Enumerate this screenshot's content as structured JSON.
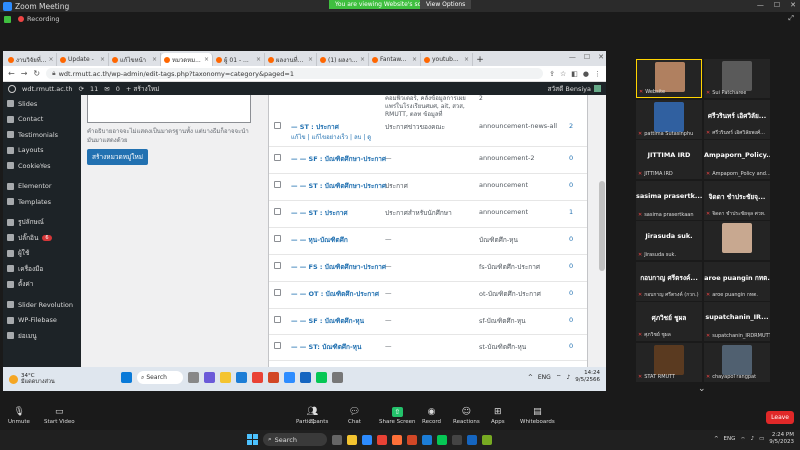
{
  "zoom": {
    "title": "Zoom Meeting",
    "share_notice": "You are viewing Website's screen",
    "view_options": "View Options",
    "recording": "Recording",
    "fullscreen_icon": "⤢",
    "winctl": [
      "—",
      "☐",
      "✕"
    ]
  },
  "browser": {
    "tabs": [
      {
        "label": "งานวิจัยที่...",
        "active": false
      },
      {
        "label": "Update -",
        "active": false
      },
      {
        "label": "แก้ไขหน้า",
        "active": false
      },
      {
        "label": "หมวดหม...",
        "active": true
      },
      {
        "label": "ผู้ 01 - ...",
        "active": false
      },
      {
        "label": "ผลงานที่...",
        "active": false
      },
      {
        "label": "(1) ผลงา...",
        "active": false
      },
      {
        "label": "Fantaw...",
        "active": false
      },
      {
        "label": "youtub...",
        "active": false
      }
    ],
    "new_tab": "+",
    "url": "wdt.rmutt.ac.th/wp-admin/edit-tags.php?taxonomy=category&paged=1"
  },
  "wp_admin_bar": {
    "site": "wdt.rmutt.ac.th",
    "updates": "11",
    "comments": "0",
    "new": "+ สร้างใหม่",
    "greeting": "สวัสดี Bensiya"
  },
  "sidebar": {
    "items": [
      {
        "label": "Slides",
        "badge": ""
      },
      {
        "label": "Contact",
        "badge": ""
      },
      {
        "label": "Testimonials",
        "badge": ""
      },
      {
        "label": "Layouts",
        "badge": ""
      },
      {
        "label": "CookieYes",
        "badge": ""
      },
      {
        "label": "Elementor",
        "badge": ""
      },
      {
        "label": "Templates",
        "badge": ""
      },
      {
        "label": "รูปลักษณ์",
        "badge": ""
      },
      {
        "label": "ปลั๊กอิน",
        "badge": "6"
      },
      {
        "label": "ผู้ใช้",
        "badge": ""
      },
      {
        "label": "เครื่องมือ",
        "badge": ""
      },
      {
        "label": "ตั้งค่า",
        "badge": ""
      },
      {
        "label": "Slider Revolution",
        "badge": ""
      },
      {
        "label": "WP-Filebase",
        "badge": ""
      },
      {
        "label": "ย่อเมนู",
        "badge": ""
      }
    ]
  },
  "form": {
    "help_text": "คำอธิบายอาจจะไม่แสดงเป็นมาตรฐานทั้ง แต่บางธีมก็อาจจะนำมันมาแสดงด้วย",
    "add_button": "สร้างหมวดหมู่ใหม่"
  },
  "table": {
    "top_desc": [
      "คอมพิวเตอร์, คลังข้อมูลการเผย",
      "แพร่ในโรงเรียนศมศ, ait, สวส,",
      "RMUTT, ตลท ข้อมูลที่"
    ],
    "top_count": "2",
    "row_actions": "แก้ไข | แก้ไขอย่างเร็ว | ลบ | ดู",
    "rows": [
      {
        "name": "— ST : ประกาศ",
        "desc": "ประกาศข่าวของคณะ",
        "slug": "announcement-news-all",
        "count": "2"
      },
      {
        "name": "— — SF : บัณฑิตศึกษา-ประกาศ",
        "desc": "—",
        "slug": "announcement-2",
        "count": "0"
      },
      {
        "name": "— — ST : บัณฑิตศึกษา-ประกาศ",
        "desc": "ประกาศ",
        "slug": "announcement",
        "count": "0"
      },
      {
        "name": "— — ST : ประกาศ",
        "desc": "ประกาศสำหรับนักศึกษา",
        "slug": "announcement",
        "count": "1"
      },
      {
        "name": "— — หุน-บัณฑิตศึก",
        "desc": "—",
        "slug": "บัณฑิตศึก-หุน",
        "count": "0"
      },
      {
        "name": "— — FS : บัณฑิตศึกษา-ประกาศ",
        "desc": "—",
        "slug": "fs-บัณฑิตศึก-ประกาศ",
        "count": "0"
      },
      {
        "name": "— — OT : บัณฑิตศึก-ประกาศ",
        "desc": "—",
        "slug": "ot-บัณฑิตศึก-ประกาศ",
        "count": "0"
      },
      {
        "name": "— — SF : บัณฑิตศึก-หุน",
        "desc": "—",
        "slug": "sf-บัณฑิตศึก-หุน",
        "count": "0"
      },
      {
        "name": "— — ST: บัณฑิตศึก-หุน",
        "desc": "—",
        "slug": "st-บัณฑิตศึก-หุน",
        "count": "0"
      }
    ]
  },
  "inner_taskbar": {
    "temp": "34°C",
    "weather": "มีแดดบางส่วน",
    "search": "Search",
    "lang": "ENG",
    "time": "14:24",
    "date": "9/5/2566"
  },
  "participants": [
    {
      "big": "",
      "small": "Website",
      "photo": "#b08060",
      "active": true
    },
    {
      "big": "",
      "small": "Sui Patcharee",
      "photo": "#5a5a5a",
      "active": false
    },
    {
      "big": "",
      "small": "pattima Sutasinphu",
      "photo": "#3060a0",
      "active": false
    },
    {
      "big": "ศรีวรินทร์ เอิศวิลัย...",
      "small": "ศรีวรินทร์ เอิศวิลัยพงศ์...",
      "photo": "",
      "active": false
    },
    {
      "big": "JITTIMA IRD",
      "small": "JITTIMA IRD",
      "photo": "",
      "active": false
    },
    {
      "big": "Ampaporn_Policy...",
      "small": "Ampaporn_Policy and...",
      "photo": "",
      "active": false
    },
    {
      "big": "sasima prasertk...",
      "small": "sasima prasertkaan",
      "photo": "",
      "active": false
    },
    {
      "big": "จิดดา ชำประชัยจุ...",
      "small": "จิดดา ชำประชัยจุล ศวท.",
      "photo": "",
      "active": false
    },
    {
      "big": "Jirasuda suk.",
      "small": "Jirasuda suk.",
      "photo": "",
      "active": false
    },
    {
      "big": "",
      "small": "",
      "photo": "#c8a890",
      "active": false
    },
    {
      "big": "กอบกาญ ศรีตรงค์...",
      "small": "กอบกาญ ศรีตรงค์ (กวก.)",
      "photo": "",
      "active": false
    },
    {
      "big": "aroe puangin กทต.",
      "small": "aroe puangin กทต.",
      "photo": "",
      "active": false
    },
    {
      "big": "ศุภวิชย์ ชูผล",
      "small": "ศุภวิชย์ ชูผล",
      "photo": "",
      "active": false
    },
    {
      "big": "supatchanin_IR...",
      "small": "supatchanin_IRDRMUTT",
      "photo": "",
      "active": false
    },
    {
      "big": "",
      "small": "STAT RMUTT",
      "photo": "#5a3a20",
      "active": false
    },
    {
      "big": "",
      "small": "chayapol rangpat",
      "photo": "#506070",
      "active": false
    }
  ],
  "zoom_toolbar": {
    "unmute": "Unmute",
    "start_video": "Start Video",
    "participants": "Participants",
    "participants_count": "21",
    "chat": "Chat",
    "share": "Share Screen",
    "record": "Record",
    "reactions": "Reactions",
    "apps": "Apps",
    "whiteboards": "Whiteboards",
    "leave": "Leave"
  },
  "win_taskbar": {
    "search": "Search",
    "lang": "ENG",
    "time": "2:24 PM",
    "date": "9/5/2023"
  },
  "colors": {
    "accent": "#2271b1",
    "share_green": "#23c26b",
    "leave_red": "#e02828"
  }
}
